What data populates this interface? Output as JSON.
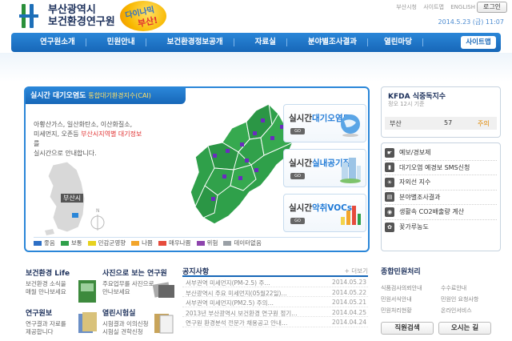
{
  "header": {
    "org_line1": "부산광역시",
    "org_line2": "보건환경연구원",
    "slogan1": "다이나믹",
    "slogan2": "부산!",
    "top_links": [
      "부산시청",
      "사이트맵",
      "ENGLISH"
    ],
    "login": "로그인",
    "date": "2014.5.23 (금) 11:07"
  },
  "nav": {
    "items": [
      "연구원소개",
      "민원안내",
      "보건환경정보공개",
      "자료실",
      "분야별조사결과",
      "열린마당"
    ],
    "sitemap": "사이트맵"
  },
  "air": {
    "tab_title": "실시간 대기오염도",
    "tab_sub": "통합대기환경지수(CAI)",
    "desc_a": "아황산가스, 일산화탄소, 이산화질소,",
    "desc_b": "미세먼지, 오존등",
    "desc_hl": "부산시지역별 대기정보",
    "desc_c": "를",
    "desc_d": "실시간으로 안내합니다.",
    "busan_label": "부산시",
    "legend": [
      {
        "label": "좋음",
        "color": "#2d6fc5"
      },
      {
        "label": "보통",
        "color": "#2fa04a"
      },
      {
        "label": "민감군영향",
        "color": "#e7d21e"
      },
      {
        "label": "나쁨",
        "color": "#f3a52a"
      },
      {
        "label": "매우나쁨",
        "color": "#e64b3c"
      },
      {
        "label": "위험",
        "color": "#8e44ad"
      },
      {
        "label": "데이터없음",
        "color": "#9aa0a6"
      }
    ],
    "buttons": [
      {
        "prefix": "실시간",
        "accent": "대기오염도",
        "go": "GO"
      },
      {
        "prefix": "실시간",
        "accent": "실내공기질",
        "go": "GO"
      },
      {
        "prefix": "실시간",
        "accent": "악취VOCs",
        "go": "GO"
      }
    ]
  },
  "kfda": {
    "title": "KFDA 식중독지수",
    "sub": "정오 12시 기준",
    "region": "부산",
    "value": "57",
    "status": "주의"
  },
  "quick_menu": [
    "예보/경보제",
    "대기오염 예경보 SMS신청",
    "자외선 지수",
    "분야별조사결과",
    "생활속 CO2배출량 계산",
    "꽃가루농도"
  ],
  "life": {
    "title": "보건환경 Life",
    "text1": "보건환경 소식을",
    "text2": "매월 만나보세요"
  },
  "photo": {
    "title": "사진으로 보는 연구원",
    "text1": "주요업무를 사진으로",
    "text2": "만나보세요"
  },
  "report": {
    "title": "연구원보",
    "text1": "연구결과 자료를",
    "text2": "제공합니다"
  },
  "open": {
    "title": "열린시험실",
    "text1": "시험결과 이의신청",
    "text2": "시험실 견학신청"
  },
  "notice": {
    "title": "공지사항",
    "more": "+ 더보기",
    "rows": [
      {
        "title": "서부권역 미세먼지(PM-2.5) 주…",
        "date": "2014.05.23"
      },
      {
        "title": "부산광역시 주요 미세먼지(05월22일)…",
        "date": "2014.05.22"
      },
      {
        "title": "서부권역 미세먼지(PM2.5) 주의…",
        "date": "2014.05.21"
      },
      {
        "title": "2013년 부산광역시 보건환경 연구원 정기…",
        "date": "2014.04.25"
      },
      {
        "title": "연구원 환경분석 전문가 채용공고 안내…",
        "date": "2014.04.24"
      }
    ]
  },
  "civil": {
    "title": "종합민원처리",
    "links": [
      "식품검사의뢰안내",
      "수수료안내",
      "민원서식안내",
      "민원인 요청사항",
      "민원처리현황",
      "온라인서비스"
    ],
    "btn1": "직원검색",
    "btn2": "오시는 길"
  }
}
